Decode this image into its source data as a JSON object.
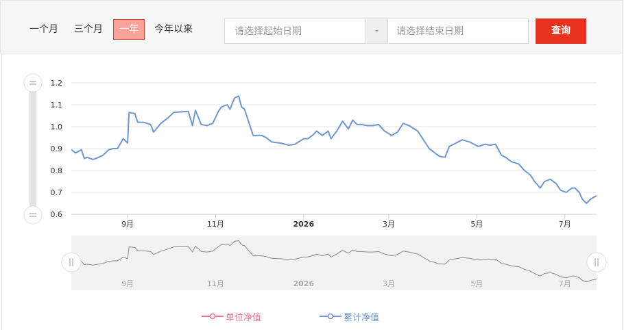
{
  "toolbar": {
    "ranges": [
      {
        "label": "一个月",
        "active": false
      },
      {
        "label": "三个月",
        "active": false
      },
      {
        "label": "一年",
        "active": true
      },
      {
        "label": "今年以来",
        "active": false
      }
    ],
    "start_placeholder": "请选择起始日期",
    "end_placeholder": "请选择结束日期",
    "separator": "-",
    "query_label": "查询"
  },
  "legend": [
    {
      "label": "单位净值",
      "color": "#e8748c"
    },
    {
      "label": "累计净值",
      "color": "#6f96cf"
    }
  ],
  "colors": {
    "series_line": "#6f96cf",
    "navigator_line": "#888888",
    "accent": "#e8321e",
    "grid": "#e6e6e6"
  },
  "chart_data": {
    "type": "line",
    "title": "",
    "xlabel": "",
    "ylabel": "",
    "ylim": [
      0.6,
      1.2
    ],
    "y_ticks": [
      "0.6",
      "0.7",
      "0.8",
      "0.9",
      "1.0",
      "1.1",
      "1.2"
    ],
    "x_range": [
      "2025-07-24",
      "2026-07-23"
    ],
    "x_ticks": [
      {
        "label": "9月",
        "date": "2025-09-01",
        "bold": false
      },
      {
        "label": "11月",
        "date": "2025-11-01",
        "bold": false
      },
      {
        "label": "2026",
        "date": "2026-01-01",
        "bold": true
      },
      {
        "label": "3月",
        "date": "2026-03-01",
        "bold": false
      },
      {
        "label": "5月",
        "date": "2026-05-01",
        "bold": false
      },
      {
        "label": "7月",
        "date": "2026-07-01",
        "bold": false
      }
    ],
    "grid": true,
    "legend_position": "bottom-center",
    "navigator": true,
    "series": [
      {
        "name": "累计净值",
        "x": [
          "2025-07-24",
          "2025-07-27",
          "2025-07-31",
          "2025-08-02",
          "2025-08-04",
          "2025-08-08",
          "2025-08-12",
          "2025-08-15",
          "2025-08-19",
          "2025-08-22",
          "2025-08-25",
          "2025-08-29",
          "2025-09-01",
          "2025-09-02",
          "2025-09-06",
          "2025-09-08",
          "2025-09-12",
          "2025-09-17",
          "2025-09-19",
          "2025-09-24",
          "2025-09-29",
          "2025-10-03",
          "2025-10-13",
          "2025-10-16",
          "2025-10-18",
          "2025-10-22",
          "2025-10-26",
          "2025-10-30",
          "2025-11-03",
          "2025-11-05",
          "2025-11-09",
          "2025-11-11",
          "2025-11-14",
          "2025-11-17",
          "2025-11-19",
          "2025-11-21",
          "2025-11-27",
          "2025-12-01",
          "2025-12-03",
          "2025-12-06",
          "2025-12-10",
          "2025-12-16",
          "2025-12-22",
          "2025-12-26",
          "2026-01-01",
          "2026-01-04",
          "2026-01-08",
          "2026-01-10",
          "2026-01-14",
          "2026-01-18",
          "2026-01-20",
          "2026-01-24",
          "2026-01-28",
          "2026-02-01",
          "2026-02-04",
          "2026-02-07",
          "2026-02-10",
          "2026-02-14",
          "2026-02-18",
          "2026-02-22",
          "2026-02-26",
          "2026-03-03",
          "2026-03-07",
          "2026-03-11",
          "2026-03-15",
          "2026-03-21",
          "2026-03-25",
          "2026-03-29",
          "2026-04-02",
          "2026-04-05",
          "2026-04-09",
          "2026-04-12",
          "2026-04-15",
          "2026-04-21",
          "2026-04-26",
          "2026-05-02",
          "2026-05-07",
          "2026-05-10",
          "2026-05-14",
          "2026-05-18",
          "2026-05-21",
          "2026-05-25",
          "2026-05-30",
          "2026-06-03",
          "2026-06-07",
          "2026-06-10",
          "2026-06-14",
          "2026-06-17",
          "2026-06-21",
          "2026-06-25",
          "2026-06-28",
          "2026-07-02",
          "2026-07-06",
          "2026-07-08",
          "2026-07-11",
          "2026-07-13",
          "2026-07-16",
          "2026-07-19",
          "2026-07-23"
        ],
        "y": [
          0.895,
          0.88,
          0.895,
          0.855,
          0.86,
          0.85,
          0.86,
          0.87,
          0.895,
          0.9,
          0.9,
          0.945,
          0.925,
          1.065,
          1.06,
          1.02,
          1.02,
          1.01,
          0.975,
          1.015,
          1.04,
          1.065,
          1.07,
          1.005,
          1.075,
          1.01,
          1.005,
          1.015,
          1.07,
          1.09,
          1.1,
          1.08,
          1.13,
          1.14,
          1.09,
          1.08,
          0.96,
          0.96,
          0.96,
          0.95,
          0.93,
          0.925,
          0.915,
          0.92,
          0.945,
          0.945,
          0.965,
          0.98,
          0.96,
          0.98,
          0.945,
          0.98,
          1.025,
          0.99,
          1.03,
          1.01,
          1.01,
          1.005,
          1.005,
          1.01,
          0.98,
          0.96,
          0.975,
          1.015,
          1.005,
          0.98,
          0.94,
          0.9,
          0.88,
          0.865,
          0.86,
          0.91,
          0.92,
          0.94,
          0.93,
          0.91,
          0.92,
          0.915,
          0.92,
          0.87,
          0.86,
          0.84,
          0.83,
          0.8,
          0.78,
          0.75,
          0.72,
          0.75,
          0.76,
          0.74,
          0.71,
          0.7,
          0.72,
          0.72,
          0.7,
          0.67,
          0.65,
          0.67,
          0.685
        ]
      }
    ]
  },
  "navigator": {
    "x_ticks": [
      "9月",
      "11月",
      "2026",
      "3月",
      "5月",
      "7月"
    ],
    "handle_glyph": "||"
  },
  "y_zoom_handle_glyph": "="
}
